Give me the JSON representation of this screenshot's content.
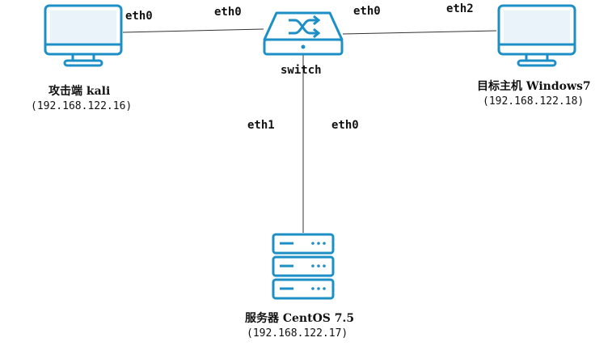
{
  "nodes": {
    "attacker": {
      "name": "攻击端 kali",
      "ip": "(192.168.122.16)",
      "port": "eth0"
    },
    "switch": {
      "name": "switch",
      "port_left": "eth0",
      "port_right": "eth0",
      "port_down_left": "eth1",
      "port_down_right": "eth0"
    },
    "target": {
      "name": "目标主机 Windows7",
      "ip": "(192.168.122.18)",
      "port": "eth2"
    },
    "server": {
      "name": "服务器 CentOS 7.5",
      "ip": "(192.168.122.17)"
    }
  },
  "colors": {
    "icon_stroke": "#1c8fc6",
    "screen_fill": "#e9f3f9",
    "link": "#333333"
  },
  "icons": [
    "monitor-icon",
    "switch-icon",
    "server-icon"
  ]
}
